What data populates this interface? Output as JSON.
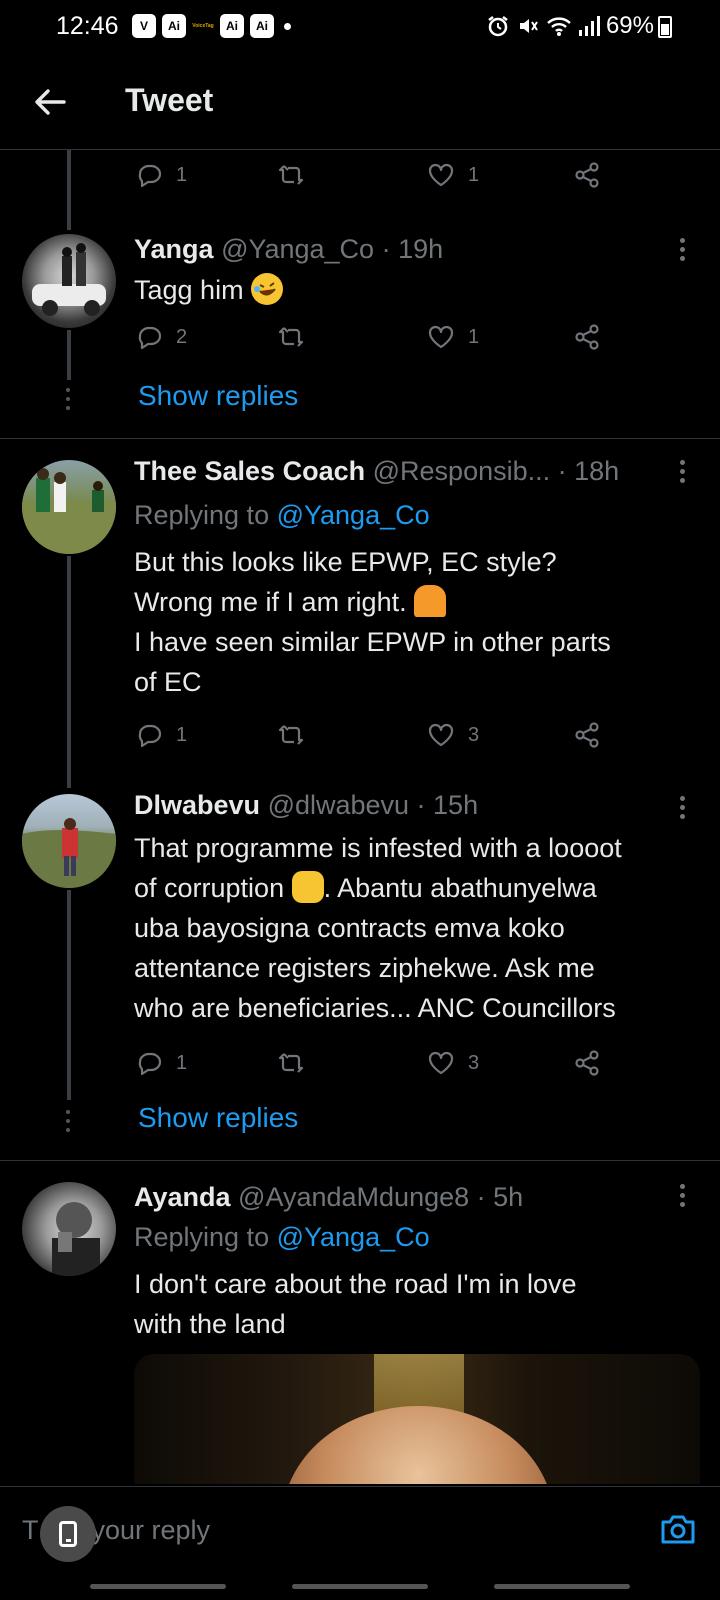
{
  "status_bar": {
    "time": "12:46",
    "badges": [
      "V",
      "Ai",
      "VoiceTag",
      "Ai",
      "Ai"
    ],
    "battery": "69%",
    "icons": [
      "alarm-icon",
      "mute-icon",
      "wifi-icon",
      "signal-icon",
      "battery-icon"
    ]
  },
  "header": {
    "title": "Tweet"
  },
  "tweets": [
    {
      "counts": {
        "replies": "1",
        "retweets": "",
        "likes": "1"
      }
    },
    {
      "name": "Yanga",
      "handle": "@Yanga_Co · 19h",
      "text": "Tagg him",
      "emoji": "rolling-on-floor-laughing",
      "counts": {
        "replies": "2",
        "retweets": "",
        "likes": "1"
      },
      "show_replies": "Show replies"
    },
    {
      "name": "Thee Sales Coach",
      "handle": "@Responsib... · 18h",
      "replying_prefix": "Replying to",
      "replying_to": "@Yanga_Co",
      "lines": [
        "But this looks like EPWP, EC style?",
        "Wrong me if I am right.",
        "I have seen similar EPWP in other parts",
        "of EC"
      ],
      "emoji": "person-shrugging",
      "counts": {
        "replies": "1",
        "retweets": "",
        "likes": "3"
      }
    },
    {
      "name": "Dlwabevu",
      "handle": "@dlwabevu · 15h",
      "lines": [
        "That programme is infested with a loooot",
        "of corruption",
        ". Abantu abathunyelwa",
        "uba bayosigna contracts emva koko",
        "attentance registers ziphekwe. Ask me",
        "who are beneficiaries... ANC Councillors"
      ],
      "emoji": "crossed-fingers",
      "counts": {
        "replies": "1",
        "retweets": "",
        "likes": "3"
      },
      "show_replies": "Show replies"
    },
    {
      "name": "Ayanda",
      "handle": "@AyandaMdunge8 · 5h",
      "replying_prefix": "Replying to",
      "replying_to": "@Yanga_Co",
      "lines": [
        "I don't care about the road I'm in love",
        "with the land"
      ]
    }
  ],
  "composer": {
    "placeholder": "Tweet your reply",
    "visible_text": "T",
    "visible_text_end": "t your reply"
  },
  "colors": {
    "accent": "#1d9bf0",
    "muted": "#71767b",
    "background": "#000000"
  }
}
